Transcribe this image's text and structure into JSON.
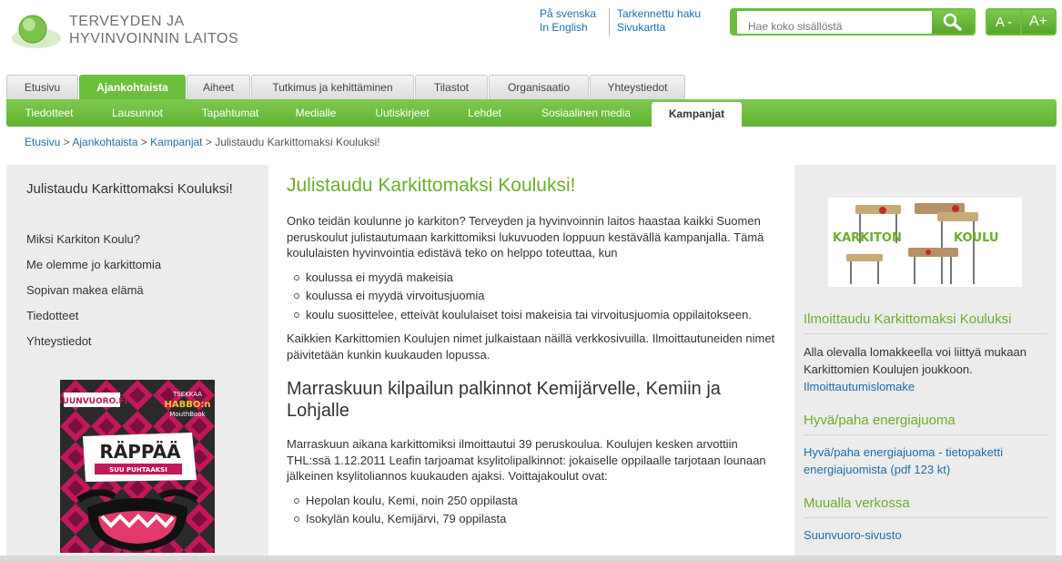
{
  "header": {
    "logo_line1": "TERVEYDEN JA",
    "logo_line2": "HYVINVOINNIN LAITOS",
    "lang_sv": "På svenska",
    "lang_en": "In English",
    "advanced_search": "Tarkennettu haku",
    "sitemap": "Sivukartta",
    "search_placeholder": "Hae koko sisällöstä",
    "font_smaller": "A -",
    "font_larger": "A+"
  },
  "main_nav": [
    "Etusivu",
    "Ajankohtaista",
    "Aiheet",
    "Tutkimus ja kehittäminen",
    "Tilastot",
    "Organisaatio",
    "Yhteystiedot"
  ],
  "sub_nav": [
    "Tiedotteet",
    "Lausunnot",
    "Tapahtumat",
    "Medialle",
    "Uutiskirjeet",
    "Lehdet",
    "Sosiaalinen media",
    "Kampanjat"
  ],
  "breadcrumb": {
    "items": [
      "Etusivu",
      "Ajankohtaista",
      "Kampanjat"
    ],
    "separator": ">",
    "current": "Julistaudu Karkittomaksi Kouluksi!"
  },
  "left": {
    "title": "Julistaudu Karkittomaksi Kouluksi!",
    "links": [
      "Miksi Karkiton Koulu?",
      "Me olemme jo karkittomia",
      "Sopivan makea elämä",
      "Tiedotteet",
      "Yhteystiedot"
    ],
    "banner": {
      "brand": "SUUNVUORO.FI",
      "tag1": "TSEKKAA",
      "tag2": "HABBO:n",
      "tag3": "MouthBook",
      "headline": "RÄPPÄÄ",
      "sub": "SUU PUHTAAKSI"
    }
  },
  "main": {
    "title": "Julistaudu Karkittomaksi Kouluksi!",
    "intro": "Onko teidän koulunne jo karkiton? Terveyden ja hyvinvoinnin laitos haastaa kaikki Suomen peruskoulut julistautumaan karkittomiksi lukuvuoden loppuun kestävällä kampanjalla. Tämä koululaisten hyvinvointia edistävä teko on helppo toteuttaa, kun",
    "bullets": [
      "koulussa ei myydä makeisia",
      "koulussa ei myydä virvoitusjuomia",
      "koulu suosittelee, etteivät koululaiset toisi makeisia tai virvoitusjuomia oppilaitokseen."
    ],
    "para2": "Kaikkien Karkittomien Koulujen nimet julkaistaan näillä verkkosivuilla. Ilmoittautuneiden nimet päivitetään kunkin kuukauden lopussa.",
    "heading2": "Marraskuun kilpailun palkinnot Kemijärvelle, Kemiin ja Lohjalle",
    "para3": "Marraskuun aikana karkittomiksi ilmoittautui 39 peruskoulua. Koulujen kesken arvottiin THL:ssä 1.12.2011 Leafin tarjoamat ksylitolipalkinnot: jokaiselle oppilaalle tarjotaan lounaan jälkeinen ksylitoliannos kuukauden ajaksi. Voittajakoulut ovat:",
    "winners": [
      "Hepolan koulu, Kemi, noin 250 oppilasta",
      "Isokylän koulu, Kemijärvi, 79 oppilasta"
    ]
  },
  "right": {
    "logo_word1": "KARKITON",
    "logo_word2": "KOULU",
    "sec1_title": "Ilmoittaudu Karkittomaksi Kouluksi",
    "sec1_text": "Alla olevalla lomakkeella voi liittyä mukaan Karkittomien Koulujen joukkoon.",
    "sec1_link": "Ilmoittautumislomake",
    "sec2_title": "Hyvä/paha energiajuoma",
    "sec2_link": "Hyvä/paha energiajuoma - tietopaketti energiajuomista (pdf 123 kt)",
    "sec3_title": "Muualla verkossa",
    "sec3_link": "Suunvuoro-sivusto"
  },
  "colors": {
    "brand_green": "#6cbf3d",
    "title_green": "#6cae2c",
    "link_blue": "#1d6fa8",
    "sidebar_gray": "#ececec"
  }
}
